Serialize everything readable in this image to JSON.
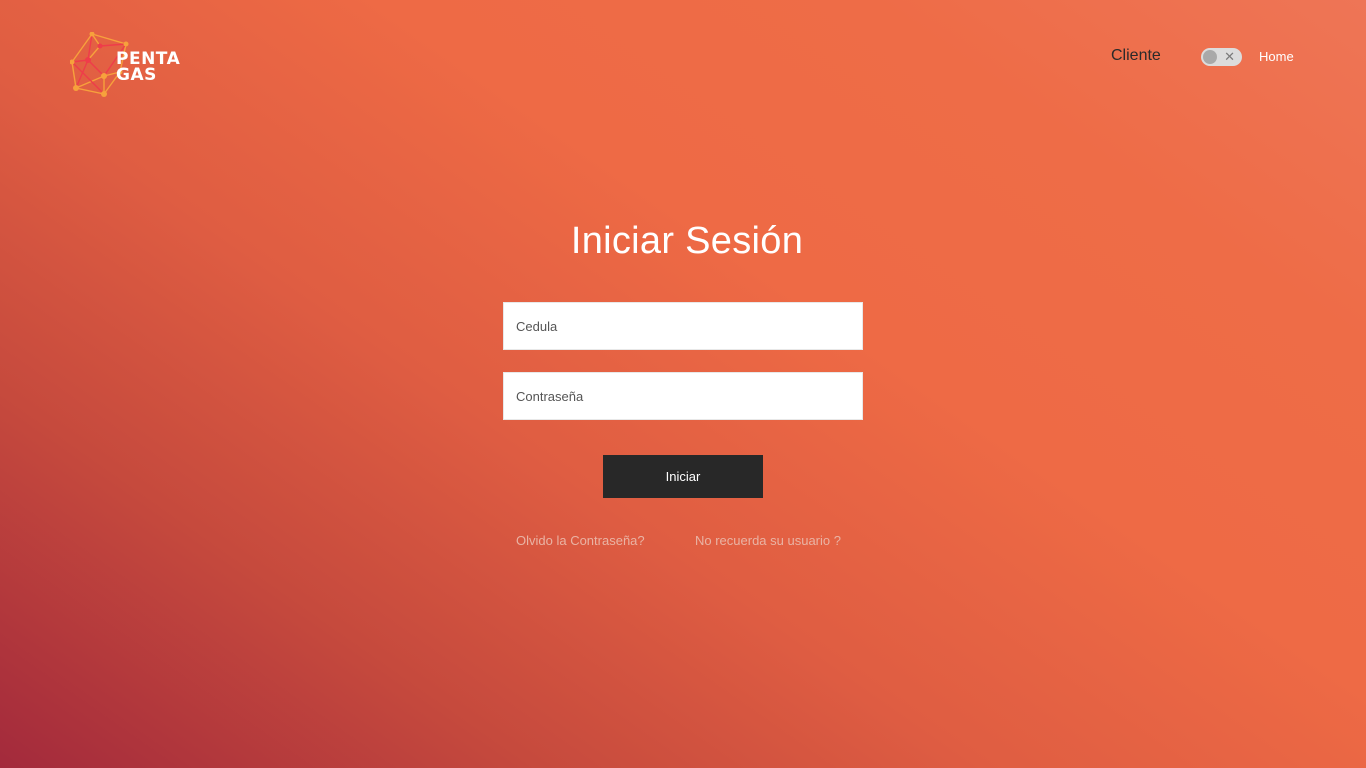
{
  "brand": {
    "line1": "PENTA",
    "line2": "GAS",
    "logo_icon": "network-polygon-logo"
  },
  "nav": {
    "cliente_label": "Cliente",
    "toggle_state": "off",
    "toggle_icon": "close-x-icon",
    "home_label": "Home"
  },
  "login": {
    "title": "Iniciar Sesión",
    "cedula_placeholder": "Cedula",
    "password_placeholder": "Contraseña",
    "submit_label": "Iniciar",
    "forgot_password_label": "Olvido la Contraseña?",
    "forgot_user_label": "No recuerda su usuario ?"
  },
  "colors": {
    "background_start": "#a32a3c",
    "background_end": "#ee7556",
    "button_bg": "#282828",
    "link": "#e9b3a4"
  }
}
